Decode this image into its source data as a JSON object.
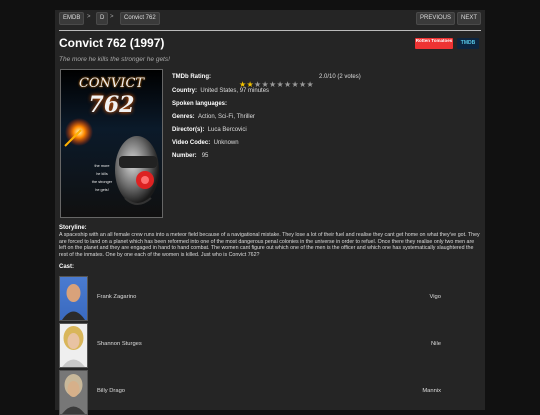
{
  "nav": {
    "breadcrumbs": [
      "EMDB",
      "D",
      "Convict 762"
    ],
    "separators": [
      ">",
      ">"
    ],
    "previous_label": "PREVIOUS",
    "next_label": "NEXT"
  },
  "movie": {
    "title": "Convict 762 (1997)",
    "tagline": "The more he kills the stronger he gets!",
    "badges": {
      "rotten": "Rotten Tomatoes",
      "tmdb": "TMDB"
    },
    "poster": {
      "title_line1": "CONVICT",
      "title_line2": "762",
      "tagline_lines": [
        "the more",
        "he kills",
        "the stronger",
        "he gets!"
      ]
    },
    "rating": {
      "label": "TMDb Rating:",
      "value": 2.0,
      "max": 10,
      "text": "2.0/10 (2 votes)",
      "star_color": "#f2c200"
    },
    "country": {
      "label": "Country:",
      "value": "United States, 97 minutes"
    },
    "languages": {
      "label": "Spoken languages:",
      "value": ""
    },
    "genres": {
      "label": "Genres:",
      "value": "Action, Sci-Fi, Thriller"
    },
    "directors": {
      "label": "Director(s):",
      "value": "Luca Bercovici"
    },
    "video_codec": {
      "label": "Video Codec:",
      "value": "Unknown"
    },
    "number": {
      "label": "Number:",
      "value": "95"
    },
    "storyline_label": "Storyline:",
    "storyline": "A spaceship with an all female crew runs into a meteor field because of a navigational mistake. They lose a lot of their fuel and realise they cant get home on what they've got. They are forced to land on a planet which has been reformed into one of the most dangerous penal colonies in the universe in order to refuel. Once there they realise only two men are left on the planet and they are engaged in hand to hand combat. The women cant figure out which one of the men is the officer and which one has systematically slaughtered the rest of the inmates. One by one each of the women is killed. Just who is Convict 762?",
    "cast_label": "Cast:",
    "cast": [
      {
        "name": "Frank Zagarino",
        "role": "Vigo"
      },
      {
        "name": "Shannon Sturges",
        "role": "Nile"
      },
      {
        "name": "Billy Drago",
        "role": "Mannix"
      }
    ]
  }
}
